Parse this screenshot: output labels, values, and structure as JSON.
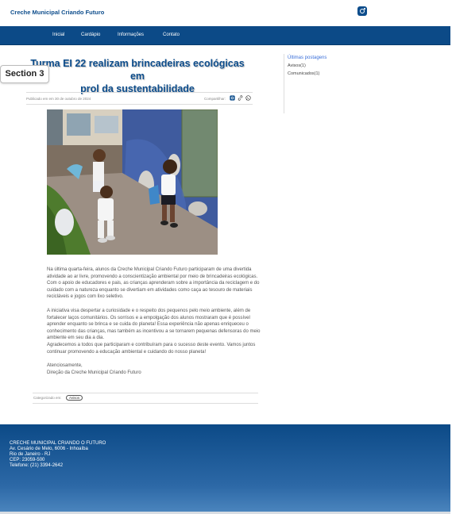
{
  "site": {
    "title": "Creche Municipal Criando Futuro"
  },
  "icons": {
    "header_social": "instagram-icon"
  },
  "nav": {
    "items": [
      "Inicial",
      "Cardápio",
      "Informações",
      "Contato"
    ]
  },
  "section_tag": "Section 3",
  "post": {
    "title_line1": "Turma EI 22 realizam brincadeiras ecológicas em",
    "title_line2": "prol da sustentabilidade",
    "published": "Publicado em em 30 de outubro de 2024",
    "share_label": "Compartilhar:",
    "paragraphs": [
      "Na última quarta-feira, alunos da Creche Municipal Criando Futuro participaram de uma divertida atividade ao ar livre, promovendo a conscientização ambiental por meio de brincadeiras ecológicas. Com o apoio de educadores e pais, as crianças aprenderam sobre a importância da reciclagem e do cuidado com a natureza enquanto se divertiam em atividades como caça ao tesouro de materiais recicláveis e jogos com lixo seletivo.",
      "A iniciativa visa despertar a curiosidade e o respeito dos pequenos pelo meio ambiente, além de fortalecer laços comunitários. Os sorrisos e a empolgação dos alunos mostraram que é possível aprender enquanto se brinca e se cuida do planeta! Essa experiência não apenas enriqueceu o conhecimento das crianças, mas também as incentivou a se tornarem pequenas defensoras do meio ambiente em seu dia a dia.",
      "Agradecemos a todos que participaram e contribuíram para o sucesso deste evento. Vamos juntos continuar promovendo a educação ambiental e cuidando do nosso planeta!"
    ],
    "closing": "Atenciosamente,",
    "signature": "Direção da Creche Municipal Criando Futuro",
    "category_label": "Categorizado em:",
    "category": "Avisos"
  },
  "sidebar": {
    "heading": "Últimas postagens",
    "items": [
      "Avisos(1)",
      "Comunicados(1)"
    ]
  },
  "footer": {
    "name": "CRECHE MUNICIPAL CRIANDO O FUTURO",
    "address": "Av. Cesário de Melo, 6006 - Inhoaíba",
    "city": "Rio de Janeiro - RJ",
    "cep": "CEP: 23059-500",
    "phone": "Telefone: (21) 3394-2642"
  },
  "colors": {
    "brand_blue": "#0c4a87",
    "accent_link": "#3a6fd9"
  }
}
